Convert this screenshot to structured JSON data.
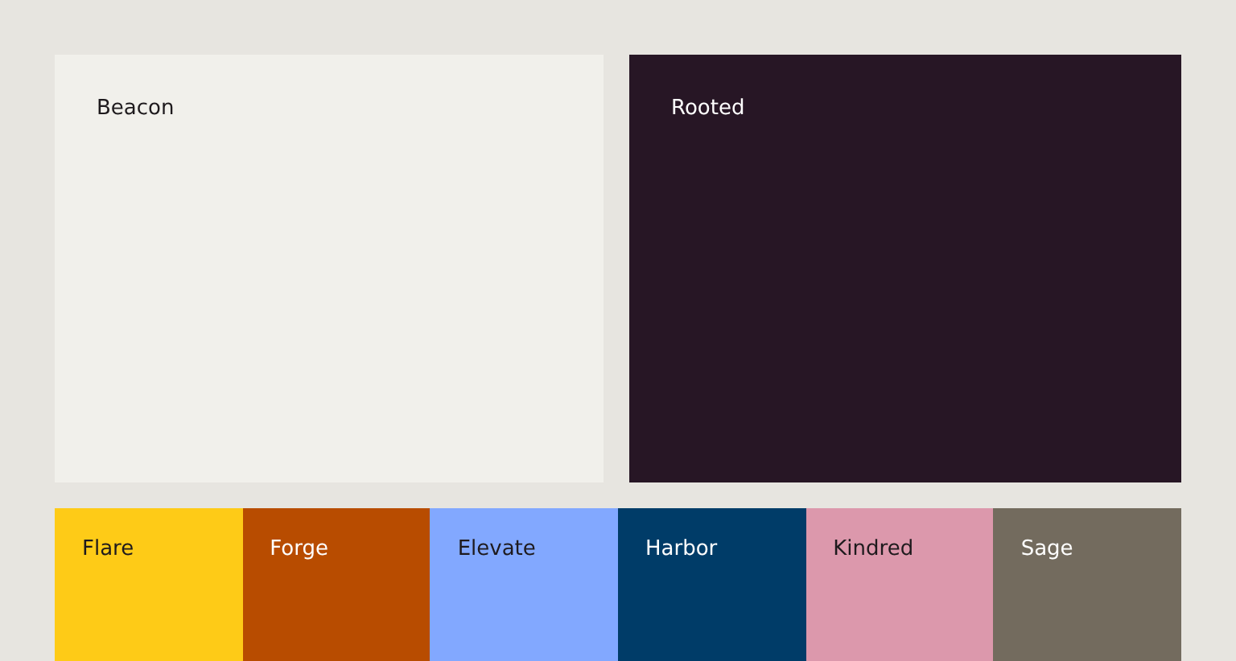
{
  "primary": [
    {
      "name": "Beacon",
      "color": "#f1f0eb"
    },
    {
      "name": "Rooted",
      "color": "#271625"
    }
  ],
  "secondary": [
    {
      "name": "Flare",
      "color": "#fecb17"
    },
    {
      "name": "Forge",
      "color": "#b84c00"
    },
    {
      "name": "Elevate",
      "color": "#82a8ff"
    },
    {
      "name": "Harbor",
      "color": "#003c68"
    },
    {
      "name": "Kindred",
      "color": "#dc98ac"
    },
    {
      "name": "Sage",
      "color": "#736b5e"
    }
  ]
}
